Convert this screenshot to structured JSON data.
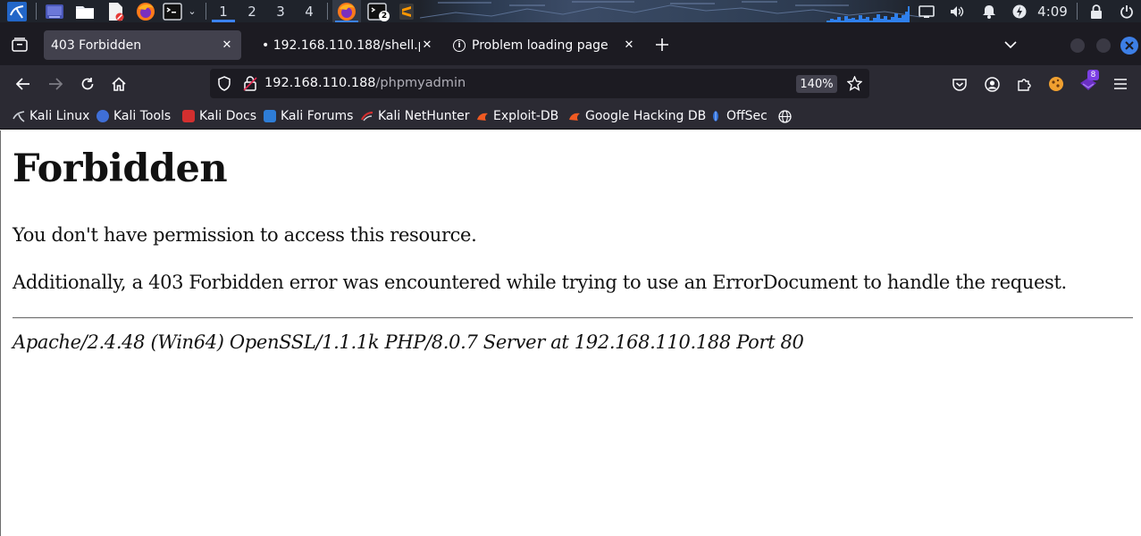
{
  "panel": {
    "workspaces": [
      "1",
      "2",
      "3",
      "4"
    ],
    "active_workspace": "1",
    "terminal_badge": "2",
    "clock": "4:09"
  },
  "tabs": [
    {
      "label": "403 Forbidden",
      "selected": true
    },
    {
      "label": "• 192.168.110.188/shell.php",
      "selected": false
    },
    {
      "label": "Problem loading page",
      "selected": false
    }
  ],
  "navbar": {
    "url_host": "192.168.110.188",
    "url_path": "/phpmyadmin",
    "zoom": "140%",
    "extension_badge": "8"
  },
  "bookmarks": [
    {
      "label": "Kali Linux",
      "icon": "kali-dragon-icon",
      "color": "#1e88e5"
    },
    {
      "label": "Kali Tools",
      "icon": "kali-tools-icon",
      "color": "#3f6fd8"
    },
    {
      "label": "Kali Docs",
      "icon": "kali-docs-icon",
      "color": "#d32f2f"
    },
    {
      "label": "Kali Forums",
      "icon": "kali-forums-icon",
      "color": "#2e7dd7"
    },
    {
      "label": "Kali NetHunter",
      "icon": "nethunter-icon",
      "color": "#d32f2f"
    },
    {
      "label": "Exploit-DB",
      "icon": "exploit-db-icon",
      "color": "#f05a22"
    },
    {
      "label": "Google Hacking DB",
      "icon": "ghdb-icon",
      "color": "#f05a22"
    },
    {
      "label": "OffSec",
      "icon": "offsec-icon",
      "color": "#2f6fd8"
    }
  ],
  "page": {
    "heading": "Forbidden",
    "paragraph1": "You don't have permission to access this resource.",
    "paragraph2": "Additionally, a 403 Forbidden error was encountered while trying to use an ErrorDocument to handle the request.",
    "address": "Apache/2.4.48 (Win64) OpenSSL/1.1.1k PHP/8.0.7 Server at 192.168.110.188 Port 80"
  }
}
